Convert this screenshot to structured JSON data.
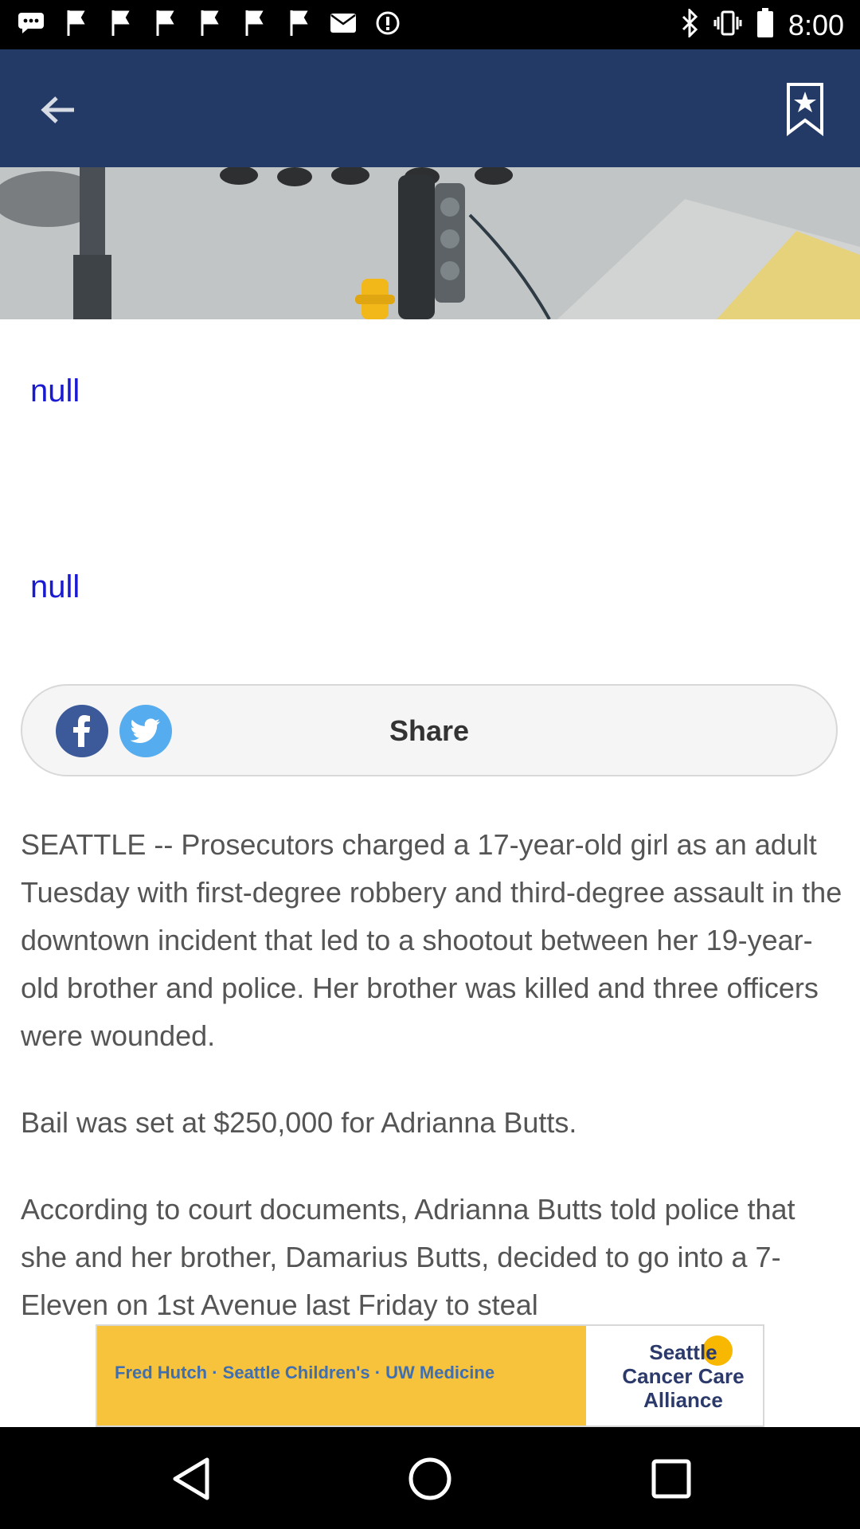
{
  "status_bar": {
    "time": "8:00",
    "icons": [
      "chat-icon",
      "flag-icon",
      "flag-icon",
      "flag-icon",
      "flag-icon",
      "flag-icon",
      "flag-icon",
      "mail-icon",
      "alert-icon"
    ],
    "right_icons": [
      "bluetooth-icon",
      "vibrate-icon",
      "battery-icon"
    ]
  },
  "app_bar": {
    "color": "#233a67",
    "back_icon": "arrow-left-icon",
    "bookmark_icon": "bookmark-star-icon"
  },
  "article": {
    "null_1": "null",
    "null_2": "null",
    "share": {
      "label": "Share",
      "facebook_icon": "facebook-icon",
      "twitter_icon": "twitter-icon"
    },
    "paragraphs": [
      "SEATTLE -- Prosecutors charged a 17-year-old girl as an adult Tuesday with first-degree robbery and third-degree assault in the downtown incident that led to a shootout between her 19-year-old brother and police. Her brother was killed and three officers were wounded.",
      "Bail was set at $250,000 for Adrianna Butts.",
      "According to court documents, Adrianna Butts told police that she and her brother, Damarius Butts, decided to go into a 7-Eleven on 1st Avenue last Friday to steal"
    ]
  },
  "ad": {
    "left_text": "Fred Hutch · Seattle Children's · UW Medicine",
    "org_text": "Seattle Cancer Care Alliance",
    "colors": {
      "background": "#f7c23c",
      "accent": "#3f6fb1"
    }
  },
  "nav_bar": {
    "back_icon": "nav-back-icon",
    "home_icon": "nav-home-icon",
    "recents_icon": "nav-recents-icon"
  }
}
